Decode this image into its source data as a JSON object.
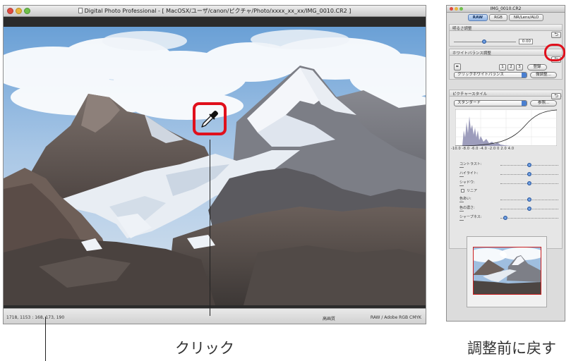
{
  "viewer": {
    "title": "Digital Photo Professional - [ MacOSX/ユーザ/canon/ピクチャ/Photo/xxxx_xx_xx/IMG_0010.CR2 ]",
    "status_coords": "1718, 1153 : 168, 173, 190",
    "status_mode": "高画質",
    "status_color": "RAW / Adobe RGB CMYK"
  },
  "palette": {
    "title": "IMG_0010.CR2",
    "tabs": [
      "RAW",
      "RGB",
      "NR/Lens/ALO"
    ],
    "brightness": {
      "label": "明るさ調整",
      "value": "0.00"
    },
    "white_balance": {
      "label": "ホワイトバランス調整",
      "presets": [
        "1",
        "2",
        "3"
      ],
      "register_label": "登録",
      "mode_value": "クリックホワイトバランス",
      "fine_tune_label": "微調整..."
    },
    "picture_style": {
      "label": "ピクチャースタイル",
      "style_value": "スタンダード",
      "browse_label": "参照...",
      "axis_ticks": [
        "-10.0",
        "-8.0",
        "-6.0",
        "-4.0",
        "-2.0",
        "0",
        "2.0",
        "4.0"
      ],
      "linear_label": "リニア",
      "sliders": [
        {
          "label": "コントラスト:",
          "value": 0
        },
        {
          "label": "ハイライト:",
          "value": 0
        },
        {
          "label": "シャドウ:",
          "value": 0
        },
        {
          "label": "色あい:",
          "value": 0
        },
        {
          "label": "色の濃さ:",
          "value": 0
        },
        {
          "label": "シャープネス:",
          "value": 3
        }
      ]
    }
  },
  "callouts": {
    "click": "クリック",
    "reset": "調整前に戻す"
  },
  "colors": {
    "highlight": "#e0101c",
    "accent": "#3a6fc2"
  },
  "icons": {
    "dropper": "eyedropper-icon",
    "reset": "undo-arrow-icon"
  }
}
